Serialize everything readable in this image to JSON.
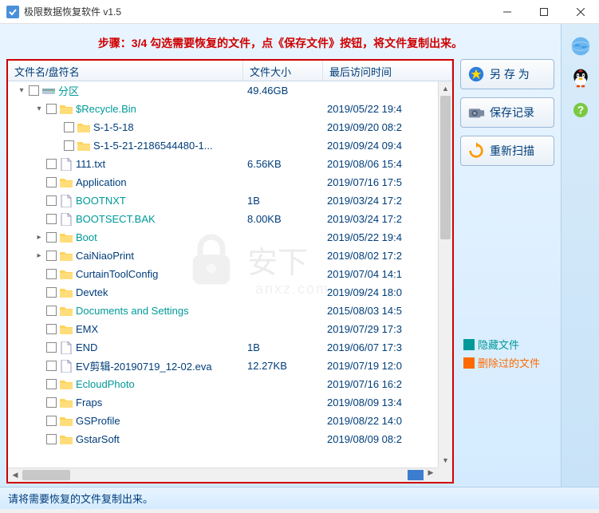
{
  "window": {
    "title": "极限数据恢复软件 v1.5"
  },
  "instruction": "步骤：3/4 勾选需要恢复的文件，点《保存文件》按钮，将文件复制出来。",
  "columns": {
    "name": "文件名/盘符名",
    "size": "文件大小",
    "date": "最后访问时间"
  },
  "buttons": {
    "save_as": "另 存 为",
    "save_record": "保存记录",
    "rescan": "重新扫描"
  },
  "legend": {
    "hidden": "隐藏文件",
    "deleted": "删除过的文件"
  },
  "colors": {
    "hidden": "#009999",
    "deleted": "#ff6a00",
    "link": "#003d7a",
    "alert": "#d00000"
  },
  "tree": [
    {
      "depth": 0,
      "expander": "▾",
      "icon": "drive",
      "name": "分区",
      "nameColor": "c-teal",
      "size": "49.46GB",
      "date": ""
    },
    {
      "depth": 1,
      "expander": "▾",
      "icon": "folder",
      "name": "$Recycle.Bin",
      "nameColor": "c-teal",
      "size": "",
      "date": "2019/05/22 19:4"
    },
    {
      "depth": 2,
      "expander": "",
      "icon": "folder",
      "name": "S-1-5-18",
      "nameColor": "c-blue",
      "size": "",
      "date": "2019/09/20 08:2"
    },
    {
      "depth": 2,
      "expander": "",
      "icon": "folder",
      "name": "S-1-5-21-2186544480-1...",
      "nameColor": "c-blue",
      "size": "",
      "date": "2019/09/24 09:4"
    },
    {
      "depth": 1,
      "expander": "",
      "icon": "file",
      "name": "111.txt",
      "nameColor": "c-blue",
      "size": "6.56KB",
      "date": "2019/08/06 15:4"
    },
    {
      "depth": 1,
      "expander": "",
      "icon": "folder",
      "name": "Application",
      "nameColor": "c-blue",
      "size": "",
      "date": "2019/07/16 17:5"
    },
    {
      "depth": 1,
      "expander": "",
      "icon": "file",
      "name": "BOOTNXT",
      "nameColor": "c-teal",
      "size": "1B",
      "date": "2019/03/24 17:2"
    },
    {
      "depth": 1,
      "expander": "",
      "icon": "file",
      "name": "BOOTSECT.BAK",
      "nameColor": "c-teal",
      "size": "8.00KB",
      "date": "2019/03/24 17:2"
    },
    {
      "depth": 1,
      "expander": "▸",
      "icon": "folder",
      "name": "Boot",
      "nameColor": "c-teal",
      "size": "",
      "date": "2019/05/22 19:4"
    },
    {
      "depth": 1,
      "expander": "▸",
      "icon": "folder",
      "name": "CaiNiaoPrint",
      "nameColor": "c-blue",
      "size": "",
      "date": "2019/08/02 17:2"
    },
    {
      "depth": 1,
      "expander": "",
      "icon": "folder",
      "name": "CurtainToolConfig",
      "nameColor": "c-blue",
      "size": "",
      "date": "2019/07/04 14:1"
    },
    {
      "depth": 1,
      "expander": "",
      "icon": "folder",
      "name": "Devtek",
      "nameColor": "c-blue",
      "size": "",
      "date": "2019/09/24 18:0"
    },
    {
      "depth": 1,
      "expander": "",
      "icon": "folder",
      "name": "Documents and Settings",
      "nameColor": "c-teal",
      "size": "",
      "date": "2015/08/03 14:5"
    },
    {
      "depth": 1,
      "expander": "",
      "icon": "folder",
      "name": "EMX",
      "nameColor": "c-blue",
      "size": "",
      "date": "2019/07/29 17:3"
    },
    {
      "depth": 1,
      "expander": "",
      "icon": "file",
      "name": "END",
      "nameColor": "c-blue",
      "size": "1B",
      "date": "2019/06/07 17:3"
    },
    {
      "depth": 1,
      "expander": "",
      "icon": "file",
      "name": "EV剪辑-20190719_12-02.eva",
      "nameColor": "c-blue",
      "size": "12.27KB",
      "date": "2019/07/19 12:0"
    },
    {
      "depth": 1,
      "expander": "",
      "icon": "folder",
      "name": "EcloudPhoto",
      "nameColor": "c-teal",
      "size": "",
      "date": "2019/07/16 16:2"
    },
    {
      "depth": 1,
      "expander": "",
      "icon": "folder",
      "name": "Fraps",
      "nameColor": "c-blue",
      "size": "",
      "date": "2019/08/09 13:4"
    },
    {
      "depth": 1,
      "expander": "",
      "icon": "folder",
      "name": "GSProfile",
      "nameColor": "c-blue",
      "size": "",
      "date": "2019/08/22 14:0"
    },
    {
      "depth": 1,
      "expander": "",
      "icon": "folder",
      "name": "GstarSoft",
      "nameColor": "c-blue",
      "size": "",
      "date": "2019/08/09 08:2"
    }
  ],
  "status": "请将需要恢复的文件复制出来。",
  "watermark": {
    "text": "安下",
    "sub": "anxz.com"
  }
}
